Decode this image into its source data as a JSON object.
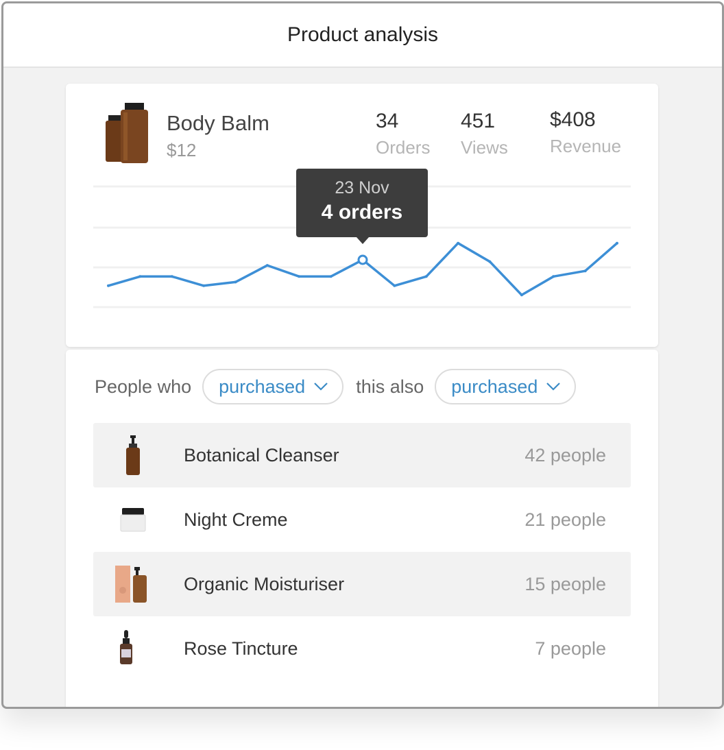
{
  "window": {
    "title": "Product analysis"
  },
  "product": {
    "name": "Body Balm",
    "price": "$12",
    "stats": [
      {
        "value": "34",
        "label": "Orders"
      },
      {
        "value": "451",
        "label": "Views"
      },
      {
        "value": "$408",
        "label": "Revenue"
      }
    ]
  },
  "tooltip": {
    "date": "23 Nov",
    "value": "4 orders"
  },
  "chart_data": {
    "type": "line",
    "series": [
      {
        "values": [
          1.6,
          2.1,
          2.1,
          1.6,
          1.8,
          2.7,
          2.1,
          2.1,
          3.0,
          1.6,
          2.1,
          3.9,
          2.9,
          1.1,
          2.1,
          2.4,
          3.9
        ]
      }
    ],
    "ylim": [
      0,
      5
    ],
    "grid": true,
    "color": "#3d8fd6",
    "highlight_index": 8
  },
  "filter": {
    "prefix": "People who",
    "first_option": "purchased",
    "middle": "this also",
    "second_option": "purchased"
  },
  "related": [
    {
      "name": "Botanical Cleanser",
      "count": "42 people",
      "icon": "pump-bottle-icon"
    },
    {
      "name": "Night Creme",
      "count": "21 people",
      "icon": "cream-jar-icon"
    },
    {
      "name": "Organic Moisturiser",
      "count": "15 people",
      "icon": "box-and-bottle-icon"
    },
    {
      "name": "Rose Tincture",
      "count": "7 people",
      "icon": "dropper-bottle-icon"
    }
  ]
}
